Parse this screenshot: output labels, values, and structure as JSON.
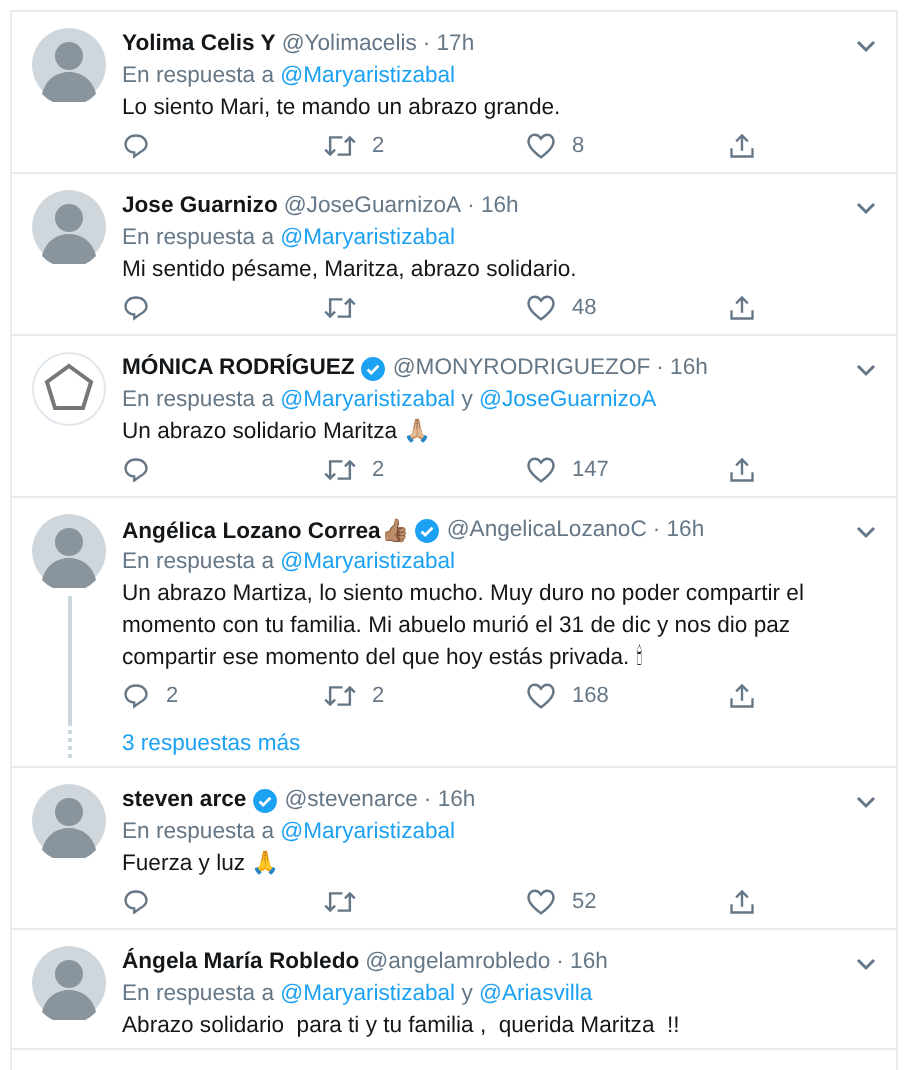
{
  "tweets": [
    {
      "name": "Yolima Celis Y",
      "handle": "@Yolimacelis",
      "time": "· 17h",
      "reply_prefix": "En respuesta a",
      "reply_to": [
        "@Maryaristizabal"
      ],
      "text": "Lo siento Mari, te mando un abrazo grande.",
      "actions": [
        {
          "kind": "reply"
        },
        {
          "kind": "retweet",
          "count": "2"
        },
        {
          "kind": "like",
          "count": "8"
        },
        {
          "kind": "share"
        }
      ]
    },
    {
      "name": "Jose Guarnizo",
      "handle": "@JoseGuarnizoA",
      "time": "· 16h",
      "reply_prefix": "En respuesta a",
      "reply_to": [
        "@Maryaristizabal"
      ],
      "text": "Mi sentido pésame, Maritza, abrazo solidario.",
      "actions": [
        {
          "kind": "reply"
        },
        {
          "kind": "retweet"
        },
        {
          "kind": "like",
          "count": "48"
        },
        {
          "kind": "share"
        }
      ]
    },
    {
      "name": "MÓNICA RODRÍGUEZ",
      "verified": true,
      "logo_avatar": true,
      "handle": "@MONYRODRIGUEZOF",
      "time": "· 16h",
      "reply_prefix": "En respuesta a",
      "reply_to": [
        "@Maryaristizabal",
        "@JoseGuarnizoA"
      ],
      "joiner": "y",
      "text": "Un abrazo solidario Maritza 🙏🏼",
      "actions": [
        {
          "kind": "reply"
        },
        {
          "kind": "retweet",
          "count": "2"
        },
        {
          "kind": "like",
          "count": "147"
        },
        {
          "kind": "share"
        }
      ]
    },
    {
      "name": "Angélica Lozano Correa👍🏽",
      "verified": true,
      "handle": "@AngelicaLozanoC",
      "time": "· 16h",
      "thread": true,
      "reply_prefix": "En respuesta a",
      "reply_to": [
        "@Maryaristizabal"
      ],
      "text": "Un abrazo Martiza, lo siento mucho. Muy duro no poder compartir el momento con tu familia. Mi abuelo murió el 31 de dic y nos dio paz compartir ese momento del que hoy estás privada. 🕯",
      "actions": [
        {
          "kind": "reply",
          "count": "2"
        },
        {
          "kind": "retweet",
          "count": "2"
        },
        {
          "kind": "like",
          "count": "168"
        },
        {
          "kind": "share"
        }
      ],
      "more_replies": "3 respuestas más"
    },
    {
      "name": "steven arce",
      "verified": true,
      "handle": "@stevenarce",
      "time": "· 16h",
      "reply_prefix": "En respuesta a",
      "reply_to": [
        "@Maryaristizabal"
      ],
      "text": "Fuerza y luz 🙏",
      "actions": [
        {
          "kind": "reply"
        },
        {
          "kind": "retweet"
        },
        {
          "kind": "like",
          "count": "52"
        },
        {
          "kind": "share"
        }
      ]
    },
    {
      "name": "Ángela María Robledo",
      "handle": "@angelamrobledo",
      "time": "· 16h",
      "reply_prefix": "En respuesta a",
      "reply_to": [
        "@Maryaristizabal",
        "@Ariasvilla"
      ],
      "joiner": "y",
      "text": "Abrazo solidario  para ti y tu familia ,  querida Maritza  !!"
    }
  ]
}
